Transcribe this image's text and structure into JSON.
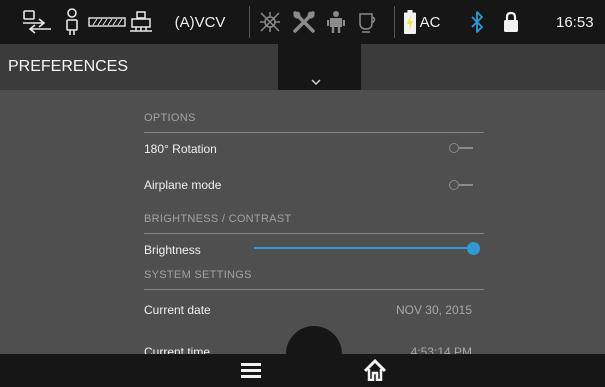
{
  "status_bar": {
    "icons": [
      "usb-transfer-icon",
      "probe-icon",
      "transducer-icon",
      "printer-icon",
      "crossed-out-icon",
      "tools-icon",
      "user-icon",
      "cup-icon",
      "battery-icon",
      "bluetooth-icon",
      "lock-icon"
    ],
    "mode_label": "(A)VCV",
    "power_label": "AC",
    "clock": "16:53",
    "colors": {
      "background": "#161616",
      "bluetooth": "#2e9ad6",
      "battery_charge": "#f2e33a"
    }
  },
  "header": {
    "title": "PREFERENCES",
    "dropdown_icon": "chevron-down-icon"
  },
  "options": {
    "header": "OPTIONS",
    "rotation": {
      "label": "180° Rotation",
      "enabled": false
    },
    "airplane": {
      "label": "Airplane mode",
      "enabled": false
    }
  },
  "brightness": {
    "header": "BRIGHTNESS / CONTRAST",
    "label": "Brightness",
    "level": 1.0,
    "accent_color": "#2e9ad6"
  },
  "system": {
    "header": "SYSTEM SETTINGS",
    "date_label": "Current date",
    "date_value": "NOV 30, 2015",
    "time_label": "Current time",
    "time_value": "4:53:14 PM"
  },
  "nav": {
    "menu_icon": "hamburger-menu-icon",
    "home_icon": "home-icon"
  }
}
